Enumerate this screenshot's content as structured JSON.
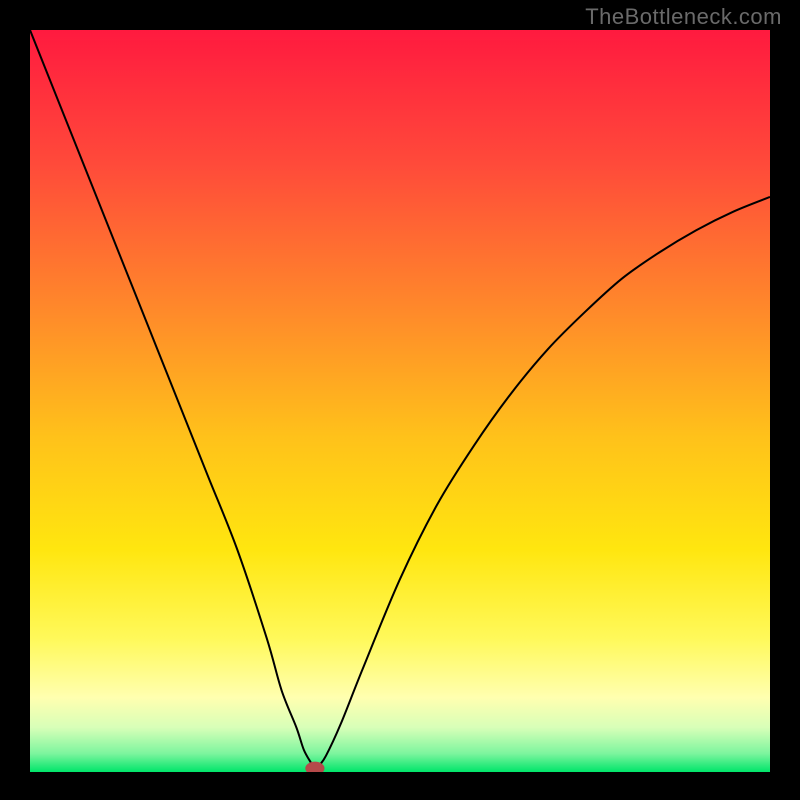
{
  "watermark": "TheBottleneck.com",
  "chart_data": {
    "type": "line",
    "title": "",
    "xlabel": "",
    "ylabel": "",
    "xlim": [
      0,
      100
    ],
    "ylim": [
      0,
      100
    ],
    "background_gradient": {
      "stops": [
        {
          "pos": 0.0,
          "color": "#ff1a3f"
        },
        {
          "pos": 0.18,
          "color": "#ff4a3a"
        },
        {
          "pos": 0.38,
          "color": "#ff8a2a"
        },
        {
          "pos": 0.55,
          "color": "#ffc21a"
        },
        {
          "pos": 0.7,
          "color": "#ffe60f"
        },
        {
          "pos": 0.82,
          "color": "#fff95a"
        },
        {
          "pos": 0.9,
          "color": "#ffffb0"
        },
        {
          "pos": 0.94,
          "color": "#d8ffb8"
        },
        {
          "pos": 0.975,
          "color": "#7df59e"
        },
        {
          "pos": 1.0,
          "color": "#00e56a"
        }
      ]
    },
    "series": [
      {
        "name": "bottleneck-curve",
        "color": "#000000",
        "x": [
          0,
          4,
          8,
          12,
          16,
          20,
          24,
          28,
          32,
          34,
          36,
          37,
          38,
          38.5,
          39,
          40,
          42,
          45,
          50,
          55,
          60,
          65,
          70,
          75,
          80,
          85,
          90,
          95,
          100
        ],
        "y": [
          100,
          90,
          80,
          70,
          60,
          50,
          40,
          30,
          18,
          11,
          6,
          3,
          1.2,
          0.4,
          0.8,
          2.2,
          6.5,
          14,
          26,
          36,
          44,
          51,
          57,
          62,
          66.5,
          70,
          73,
          75.5,
          77.5
        ]
      }
    ],
    "marker": {
      "name": "optimal-point",
      "x": 38.5,
      "y": 0.5,
      "rx": 1.3,
      "ry": 0.9,
      "fill": "#b54a4a"
    }
  }
}
